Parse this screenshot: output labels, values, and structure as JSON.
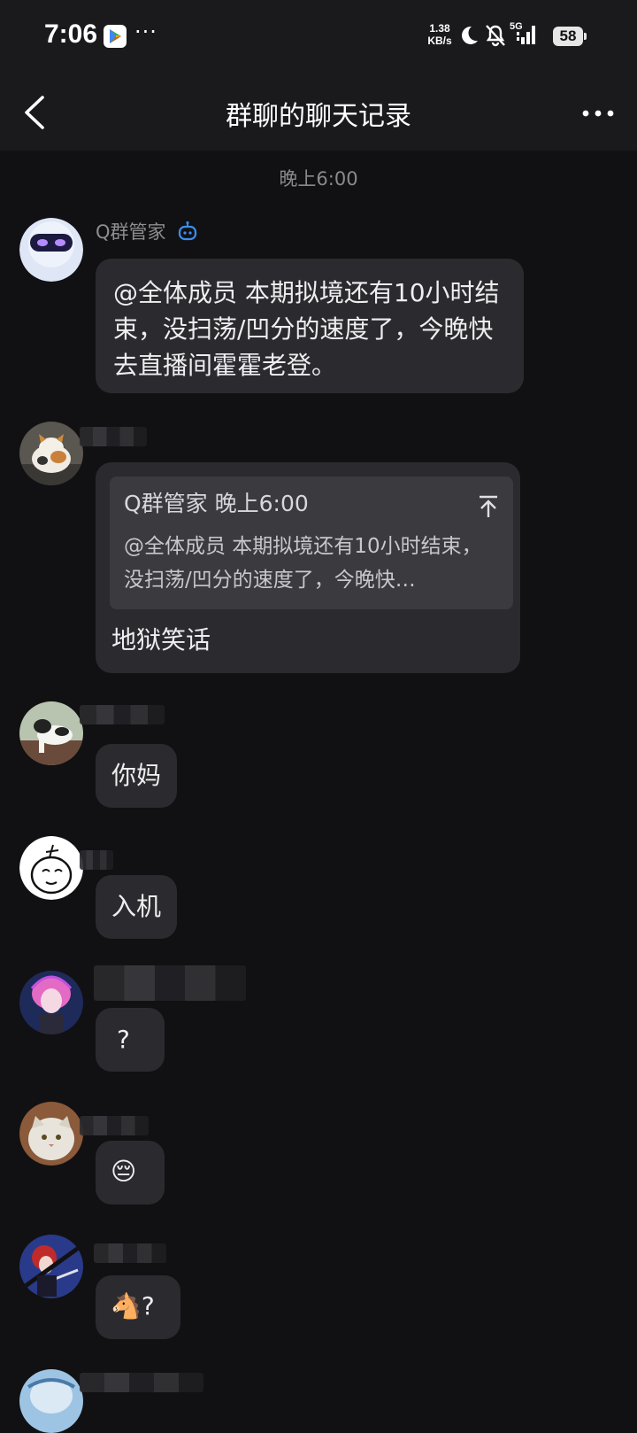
{
  "status_bar": {
    "time": "7:06",
    "speed": "1.38\nKB/s",
    "network": "5G",
    "battery": "58",
    "icons": [
      "play-store-icon",
      "more-dots-icon",
      "moon-icon",
      "bell-off-icon",
      "signal-icon",
      "battery-icon"
    ]
  },
  "nav": {
    "title": "群聊的聊天记录",
    "back_icon": "back-chevron-icon",
    "more_icon": "more-horizontal-icon"
  },
  "chat": {
    "timestamp": "晚上6:00",
    "messages": [
      {
        "sender": "Q群管家",
        "is_bot": true,
        "text": "@全体成员 本期拟境还有10小时结束，没扫荡/凹分的速度了，今晚快去直播间霍霍老登。"
      },
      {
        "sender": "",
        "quote": {
          "header": "Q群管家 晚上6:00",
          "text": "@全体成员 本期拟境还有10小时结束，没扫荡/凹分的速度了，今晚快…"
        },
        "text": "地狱笑话"
      },
      {
        "sender": "",
        "text": "你妈"
      },
      {
        "sender": "",
        "text": "入机"
      },
      {
        "sender": "",
        "text": "?"
      },
      {
        "sender": "",
        "text": "😔"
      },
      {
        "sender": "",
        "text": "🐴?"
      }
    ]
  },
  "colors": {
    "background": "#111113",
    "bar": "#1a1a1c",
    "bubble": "#2b2b2f",
    "quote": "#3a3a3f",
    "bot_badge": "#3a8ef0"
  }
}
